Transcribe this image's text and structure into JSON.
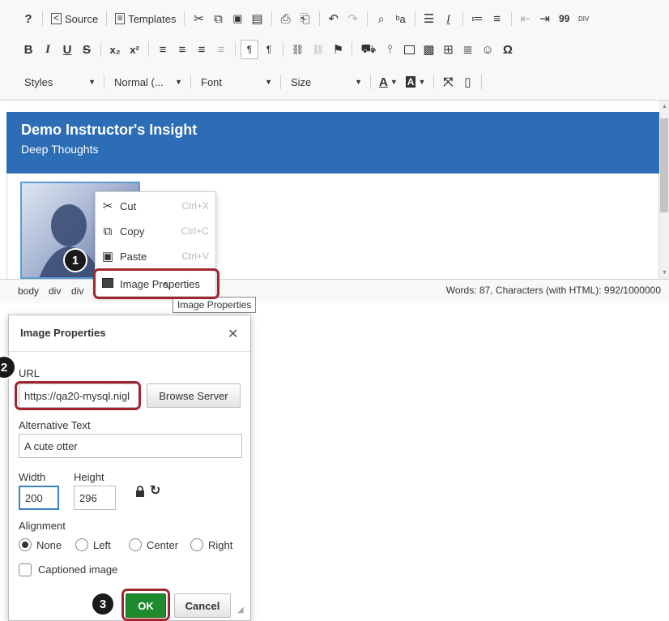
{
  "toolbar": {
    "row1": {
      "help": "?",
      "source": "Source",
      "templates": "Templates",
      "cut": "✂",
      "copy": "⧉",
      "paste": "📋",
      "paste_text": "▤",
      "print": "⎙",
      "find": "🔍",
      "replace": "ᵇa",
      "block": "☰",
      "clear_format": "I",
      "numbered_list": "≔",
      "bullet_list": "≡",
      "outdent": "⇤",
      "indent": "⇥",
      "blockquote": "99",
      "div": "DIV"
    },
    "row2": {
      "bold": "B",
      "italic": "I",
      "underline": "U",
      "strike": "S",
      "subscript": "x₂",
      "superscript": "x²",
      "align_left": "≡",
      "align_center": "≡",
      "align_right": "≡",
      "justify": "≡",
      "ltr": "¶",
      "rtl": "¶",
      "link": "⛓",
      "unlink": "⛓",
      "anchor": "⚑",
      "cart": "🛒",
      "pin": "📍",
      "image": "🖼",
      "media": "🎬",
      "table": "⊞",
      "hline": "≣",
      "smiley": "☺",
      "omega": "Ω"
    },
    "row3": {
      "styles": "Styles",
      "format": "Normal (...",
      "font": "Font",
      "size": "Size",
      "text_color": "A",
      "bg_color": "A",
      "maximize": "⤧",
      "blocks": "▯"
    }
  },
  "editor": {
    "banner_title": "Demo Instructor's Insight",
    "banner_subtitle": "Deep Thoughts"
  },
  "statusbar": {
    "path": [
      "body",
      "div",
      "div"
    ],
    "wordcount": "Words: 87, Characters (with HTML): 992/1000000"
  },
  "context_menu": {
    "items": [
      {
        "label": "Cut",
        "shortcut": "Ctrl+X",
        "icon": "scissors-icon"
      },
      {
        "label": "Copy",
        "shortcut": "Ctrl+C",
        "icon": "copy-icon"
      },
      {
        "label": "Paste",
        "shortcut": "Ctrl+V",
        "icon": "paste-icon"
      },
      {
        "label": "Image Properties",
        "shortcut": "",
        "icon": "image-icon"
      }
    ],
    "tooltip": "Image Properties"
  },
  "dialog": {
    "title": "Image Properties",
    "close": "✕",
    "url_label": "URL",
    "url_value": "https://qa20-mysql.nigl",
    "browse_button": "Browse Server",
    "alt_label": "Alternative Text",
    "alt_value": "A cute otter",
    "width_label": "Width",
    "width_value": "200",
    "height_label": "Height",
    "height_value": "296",
    "lock_icon": "🔒",
    "reset_icon": "↻",
    "alignment_label": "Alignment",
    "alignment_options": [
      "None",
      "Left",
      "Center",
      "Right"
    ],
    "alignment_selected": "None",
    "captioned_label": "Captioned image",
    "ok_button": "OK",
    "cancel_button": "Cancel"
  },
  "annotations": {
    "step1": "1",
    "step2": "2",
    "step3": "3",
    "highlight_color": "#a2262f"
  },
  "colors": {
    "banner": "#2d6db6",
    "ok_button": "#1f8a2e"
  }
}
